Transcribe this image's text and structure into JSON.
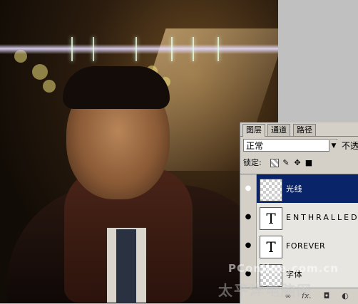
{
  "panel": {
    "tabs": [
      {
        "label": "图层",
        "active": true
      },
      {
        "label": "通道",
        "active": false
      },
      {
        "label": "路径",
        "active": false
      }
    ],
    "blend_mode": "正常",
    "opacity_label": "不透",
    "lock_label": "锁定:",
    "layers": [
      {
        "name": "光线",
        "thumbnail": "transparent",
        "selected": true,
        "visible": true
      },
      {
        "name": "ENTHRALLED",
        "thumbnail": "T",
        "selected": false,
        "visible": true
      },
      {
        "name": "FOREVER",
        "thumbnail": "T",
        "selected": false,
        "visible": true
      },
      {
        "name": "字体",
        "thumbnail": "transparent",
        "selected": false,
        "visible": true
      }
    ],
    "footer_icons": [
      "link-icon",
      "fx-icon",
      "mask-icon",
      "adjustment-icon"
    ],
    "footer_labels": {
      "link": "∞",
      "fx": "fx.",
      "mask": "◘",
      "adjust": "◐"
    }
  },
  "watermark": {
    "line1": "PConline.com.cn",
    "line2": "太平洋电脑网"
  },
  "colors": {
    "selected_layer": "#0a246a",
    "panel_bg": "#d4d0c8",
    "background": "#c0c0c0"
  }
}
